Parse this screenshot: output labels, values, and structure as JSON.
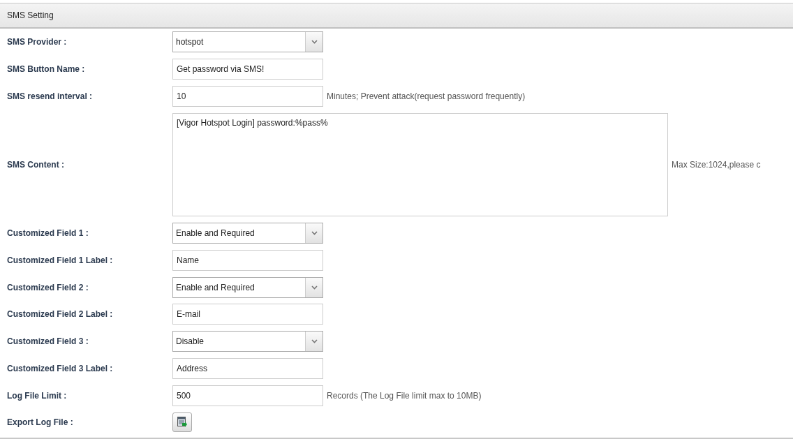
{
  "section": {
    "title": "SMS Setting"
  },
  "rows": [
    {
      "kind": "select",
      "label": "SMS Provider :",
      "value": "hotspot"
    },
    {
      "kind": "input",
      "label": "SMS Button Name :",
      "value": "Get password via SMS!"
    },
    {
      "kind": "input",
      "label": "SMS resend interval :",
      "value": "10",
      "hint": "Minutes; Prevent attack(request password frequently)"
    },
    {
      "kind": "textarea",
      "label": "SMS Content :",
      "value": "[Vigor Hotspot Login] password:%pass%",
      "hint": "Max Size:1024,please c"
    },
    {
      "kind": "select",
      "label": "Customized Field 1 :",
      "value": "Enable and Required"
    },
    {
      "kind": "input",
      "label": "Customized Field 1 Label :",
      "value": "Name"
    },
    {
      "kind": "select",
      "label": "Customized Field 2 :",
      "value": "Enable and Required"
    },
    {
      "kind": "input",
      "label": "Customized Field 2 Label :",
      "value": "E-mail"
    },
    {
      "kind": "select",
      "label": "Customized Field 3 :",
      "value": "Disable"
    },
    {
      "kind": "input",
      "label": "Customized Field 3 Label :",
      "value": "Address"
    },
    {
      "kind": "input",
      "label": "Log File Limit :",
      "value": "500",
      "hint": "Records (The Log File limit max to 10MB)"
    },
    {
      "kind": "export",
      "label": "Export Log File :"
    }
  ]
}
